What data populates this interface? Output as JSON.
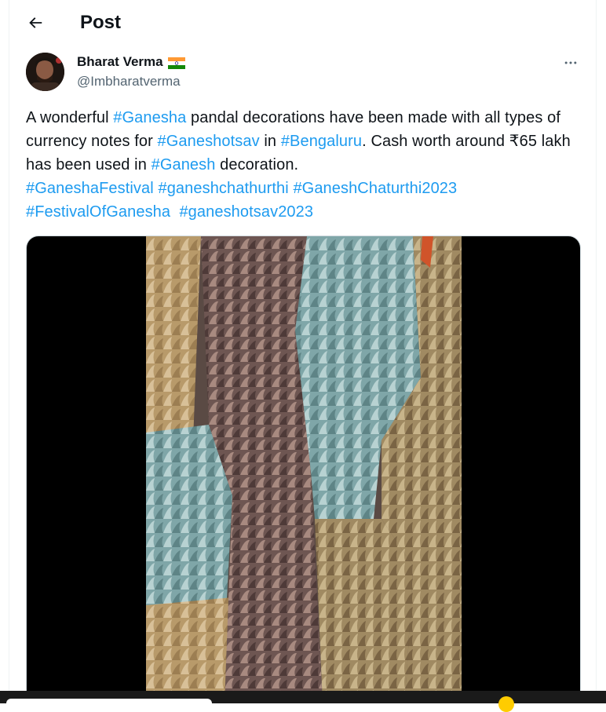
{
  "header": {
    "title": "Post"
  },
  "author": {
    "name": "Bharat Verma",
    "handle": "@Imbharatverma",
    "flag_icon": "india-flag-icon"
  },
  "tweet": {
    "segments": [
      {
        "text": "A wonderful ",
        "type": "text"
      },
      {
        "text": "#Ganesha",
        "type": "hashtag"
      },
      {
        "text": " pandal decorations have been made with all types of currency notes for ",
        "type": "text"
      },
      {
        "text": "#Ganeshotsav",
        "type": "hashtag"
      },
      {
        "text": " in ",
        "type": "text"
      },
      {
        "text": "#Bengaluru",
        "type": "hashtag"
      },
      {
        "text": ". Cash worth around ₹65 lakh has been used in ",
        "type": "text"
      },
      {
        "text": "#Ganesh",
        "type": "hashtag"
      },
      {
        "text": " decoration.",
        "type": "text"
      }
    ],
    "hashtag_lines": [
      [
        "#GaneshaFestival",
        "#ganeshchathurthi",
        "#GaneshChaturthi2023"
      ],
      [
        "#FestivalOfGanesha",
        "#ganeshotsav2023"
      ]
    ]
  },
  "colors": {
    "hashtag": "#1d9bf0",
    "muted": "#536471",
    "text": "#0f1419"
  },
  "icons": {
    "back": "arrow-left-icon",
    "more": "more-horizontal-icon"
  }
}
